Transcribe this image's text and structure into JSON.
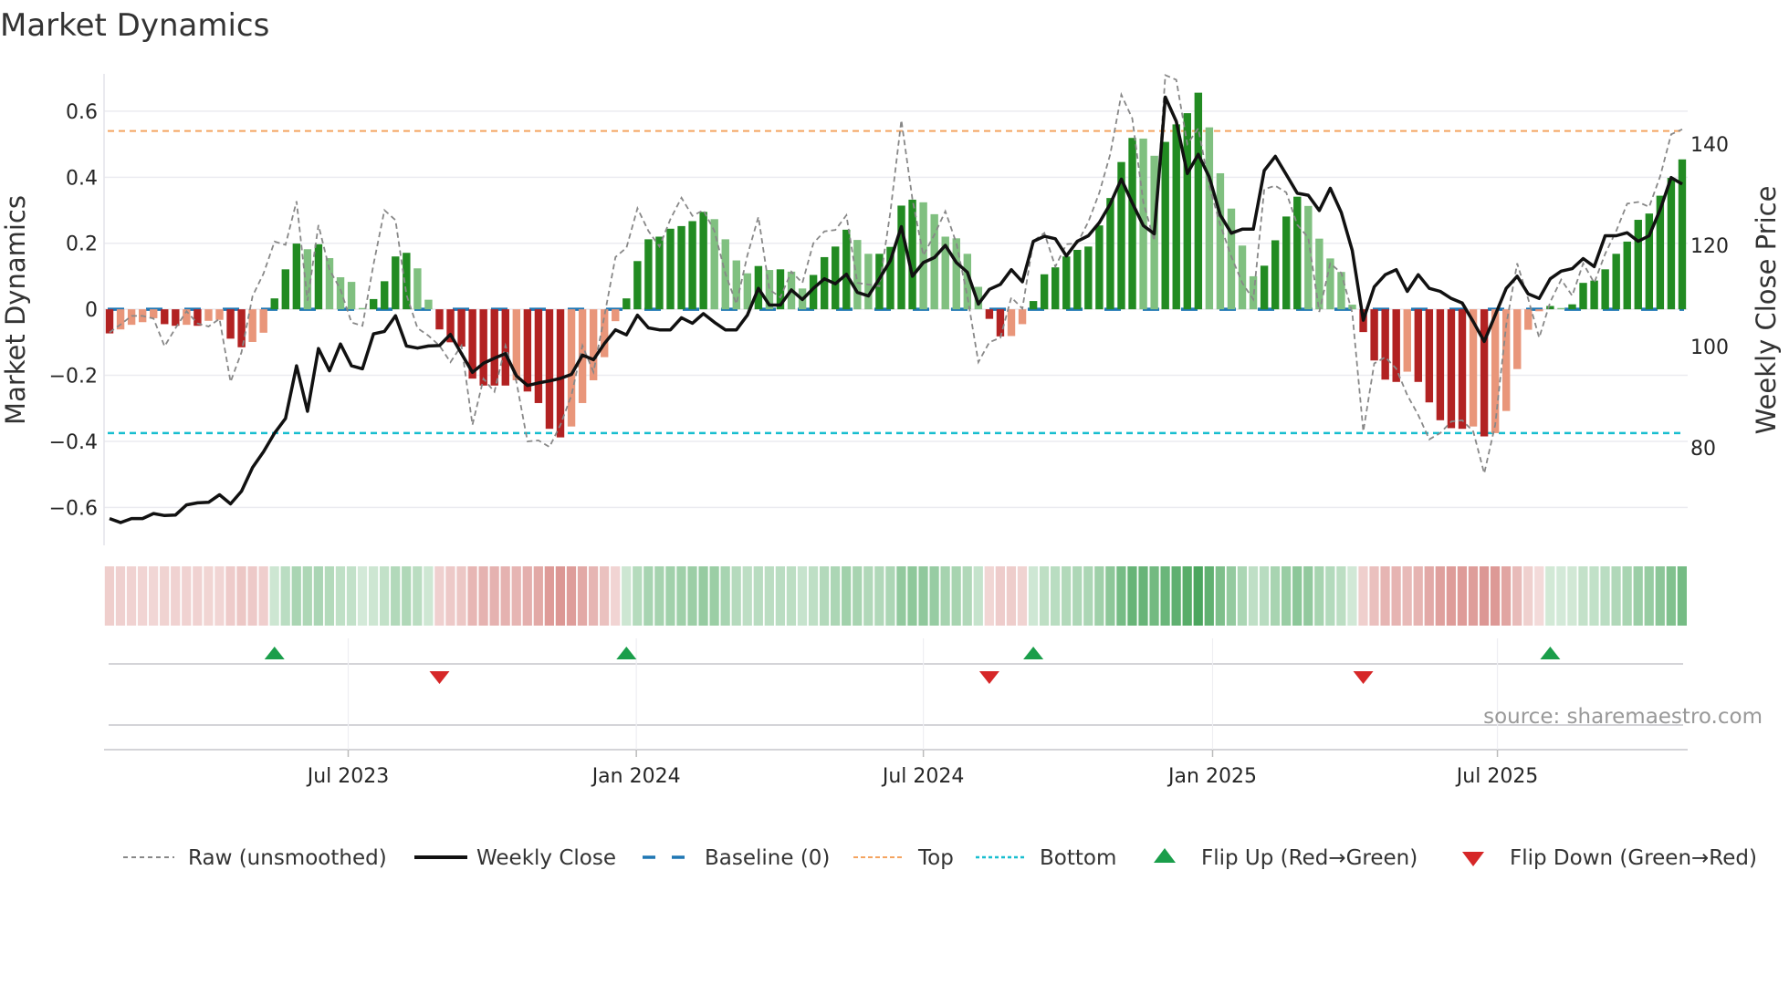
{
  "chart_data": {
    "type": "bar",
    "title": "Market Dynamics",
    "ylabel": "Market Dynamics",
    "y2label": "Weekly Close Price",
    "ylim": [
      -0.715,
      0.713
    ],
    "y2lim": [
      60.7,
      153.9
    ],
    "yticks": [
      0.6,
      0.4,
      0.2,
      0,
      -0.2,
      -0.4,
      -0.6
    ],
    "ytick_labels": [
      "0.6",
      "0.4",
      "0.2",
      "0",
      "−0.2",
      "−0.4",
      "−0.6"
    ],
    "y2ticks": [
      140,
      120,
      100,
      80
    ],
    "y2tick_labels": [
      "140",
      "120",
      "100",
      "80"
    ],
    "xticks": [
      {
        "label": "Jul 2023",
        "week": 22.7
      },
      {
        "label": "Jan 2024",
        "week": 48.9
      },
      {
        "label": "Jul 2024",
        "week": 75.0
      },
      {
        "label": "Jan 2025",
        "week": 101.3
      },
      {
        "label": "Jul 2025",
        "week": 127.2
      }
    ],
    "grid": true,
    "top_level": 0.54,
    "bottom_level": -0.375,
    "baseline": 0,
    "smoothed": [
      -0.073,
      -0.061,
      -0.047,
      -0.039,
      -0.027,
      -0.045,
      -0.05,
      -0.047,
      -0.05,
      -0.035,
      -0.032,
      -0.089,
      -0.115,
      -0.099,
      -0.071,
      0.033,
      0.121,
      0.199,
      0.182,
      0.197,
      0.155,
      0.097,
      0.083,
      0.004,
      0.031,
      0.085,
      0.16,
      0.171,
      0.124,
      0.029,
      -0.061,
      -0.1,
      -0.113,
      -0.21,
      -0.231,
      -0.231,
      -0.231,
      -0.215,
      -0.249,
      -0.284,
      -0.362,
      -0.388,
      -0.355,
      -0.284,
      -0.215,
      -0.145,
      -0.036,
      0.033,
      0.146,
      0.212,
      0.22,
      0.244,
      0.252,
      0.267,
      0.295,
      0.273,
      0.212,
      0.148,
      0.109,
      0.131,
      0.119,
      0.121,
      0.114,
      0.063,
      0.104,
      0.158,
      0.19,
      0.241,
      0.21,
      0.168,
      0.168,
      0.189,
      0.314,
      0.332,
      0.324,
      0.288,
      0.22,
      0.215,
      0.168,
      0.068,
      -0.029,
      -0.082,
      -0.081,
      -0.045,
      0.025,
      0.106,
      0.127,
      0.16,
      0.18,
      0.19,
      0.254,
      0.337,
      0.446,
      0.519,
      0.517,
      0.465,
      0.507,
      0.56,
      0.594,
      0.656,
      0.551,
      0.412,
      0.305,
      0.193,
      0.1,
      0.132,
      0.209,
      0.281,
      0.341,
      0.313,
      0.214,
      0.154,
      0.113,
      0.014,
      -0.069,
      -0.155,
      -0.213,
      -0.22,
      -0.189,
      -0.22,
      -0.282,
      -0.336,
      -0.36,
      -0.362,
      -0.355,
      -0.385,
      -0.375,
      -0.308,
      -0.181,
      -0.062,
      -0.006,
      0.01,
      0.004,
      0.015,
      0.08,
      0.087,
      0.121,
      0.168,
      0.205,
      0.271,
      0.29,
      0.344,
      0.398,
      0.454
    ],
    "raw": [
      -0.07,
      -0.046,
      -0.02,
      -0.02,
      -0.028,
      -0.112,
      -0.057,
      -0.006,
      -0.043,
      -0.052,
      -0.029,
      -0.22,
      -0.13,
      0.04,
      0.108,
      0.205,
      0.195,
      0.327,
      0.026,
      0.255,
      0.12,
      0.06,
      -0.04,
      -0.05,
      0.136,
      0.3,
      0.27,
      0.044,
      -0.057,
      -0.08,
      -0.11,
      -0.16,
      -0.11,
      -0.35,
      -0.21,
      -0.25,
      -0.11,
      -0.22,
      -0.4,
      -0.397,
      -0.417,
      -0.35,
      -0.26,
      -0.11,
      -0.19,
      -0.02,
      0.158,
      0.186,
      0.306,
      0.237,
      0.19,
      0.273,
      0.338,
      0.283,
      0.3,
      0.237,
      0.108,
      0.016,
      0.163,
      0.28,
      0.06,
      0.036,
      0.114,
      0.08,
      0.2,
      0.236,
      0.24,
      0.285,
      0.08,
      0.075,
      0.07,
      0.295,
      0.573,
      0.334,
      0.163,
      0.226,
      0.297,
      0.2,
      0.04,
      -0.16,
      -0.1,
      -0.086,
      0.036,
      0.002,
      0.207,
      0.231,
      0.129,
      0.197,
      0.2,
      0.265,
      0.353,
      0.47,
      0.65,
      0.578,
      0.324,
      0.207,
      0.709,
      0.695,
      0.5,
      0.548,
      0.373,
      0.256,
      0.16,
      0.08,
      0.03,
      0.364,
      0.374,
      0.354,
      0.256,
      0.217,
      -0.008,
      0.139,
      0.11,
      -0.01,
      -0.37,
      -0.164,
      -0.145,
      -0.18,
      -0.26,
      -0.32,
      -0.394,
      -0.375,
      -0.34,
      -0.336,
      -0.37,
      -0.497,
      -0.35,
      -0.047,
      0.139,
      0.031,
      -0.086,
      0.022,
      0.09,
      0.041,
      0.139,
      0.08,
      0.168,
      0.237,
      0.32,
      0.325,
      0.31,
      0.403,
      0.53,
      0.545
    ],
    "weekly_close": [
      66.0,
      65.2,
      66.0,
      66.0,
      67.0,
      66.6,
      66.7,
      68.7,
      69.1,
      69.2,
      70.7,
      68.9,
      71.4,
      76.1,
      79.2,
      82.9,
      85.8,
      96.2,
      87.2,
      99.6,
      95.2,
      100.5,
      96.2,
      95.6,
      102.5,
      103.0,
      106.1,
      100.1,
      99.7,
      100.1,
      100.2,
      102.4,
      98.6,
      94.9,
      96.7,
      97.7,
      98.6,
      94.2,
      92.3,
      92.8,
      93.2,
      93.7,
      94.5,
      98.3,
      97.4,
      100.6,
      103.3,
      102.3,
      106.2,
      103.7,
      103.3,
      103.3,
      105.7,
      104.6,
      106.5,
      104.8,
      103.3,
      103.3,
      106.2,
      111.5,
      108.2,
      108.2,
      111.2,
      109.3,
      111.5,
      113.4,
      112.4,
      114.3,
      110.7,
      110.0,
      113.4,
      117.0,
      123.7,
      113.9,
      116.6,
      117.6,
      120.0,
      116.6,
      114.7,
      108.4,
      111.3,
      112.3,
      115.2,
      112.8,
      120.8,
      121.8,
      121.3,
      117.9,
      120.8,
      121.9,
      124.5,
      128.2,
      133.1,
      128.4,
      123.9,
      122.3,
      149.3,
      144.5,
      134.2,
      138.0,
      133.5,
      126.0,
      122.4,
      123.2,
      123.2,
      134.8,
      137.6,
      134.0,
      130.3,
      129.9,
      126.9,
      131.3,
      126.5,
      119.0,
      105.2,
      111.8,
      114.2,
      115.2,
      110.9,
      114.2,
      111.5,
      110.9,
      109.5,
      108.6,
      104.9,
      101.0,
      106.2,
      111.5,
      113.9,
      110.4,
      109.5,
      113.4,
      114.9,
      115.4,
      117.4,
      115.8,
      121.9,
      121.9,
      122.5,
      120.8,
      121.9,
      127.1,
      133.4,
      132.1
    ],
    "flips_up_weeks": [
      16,
      48,
      85,
      132
    ],
    "flips_down_weeks": [
      31,
      81,
      115
    ],
    "colors": {
      "pos_strong": "#228b22",
      "pos_weak": "#80c080",
      "neg_strong": "#b22222",
      "neg_weak": "#e9967a",
      "heat_pos": "#3a9e4f",
      "heat_neg": "#c85a55",
      "raw": "#888888",
      "close": "#111111",
      "baseline": "#1f77b4",
      "top": "#f4a460",
      "bottom": "#17becf",
      "flip_up": "#1a9e4a",
      "flip_down": "#d62728",
      "grid": "#ebebf0"
    },
    "legend": {
      "placement": "bottom",
      "items": [
        {
          "label": "Raw (unsmoothed)"
        },
        {
          "label": "Weekly Close"
        },
        {
          "label": "Baseline (0)"
        },
        {
          "label": "Top"
        },
        {
          "label": "Bottom"
        },
        {
          "label": "Flip Up (Red→Green)"
        },
        {
          "label": "Flip Down (Green→Red)"
        }
      ]
    },
    "annotation": "source: sharemaestro.com"
  }
}
